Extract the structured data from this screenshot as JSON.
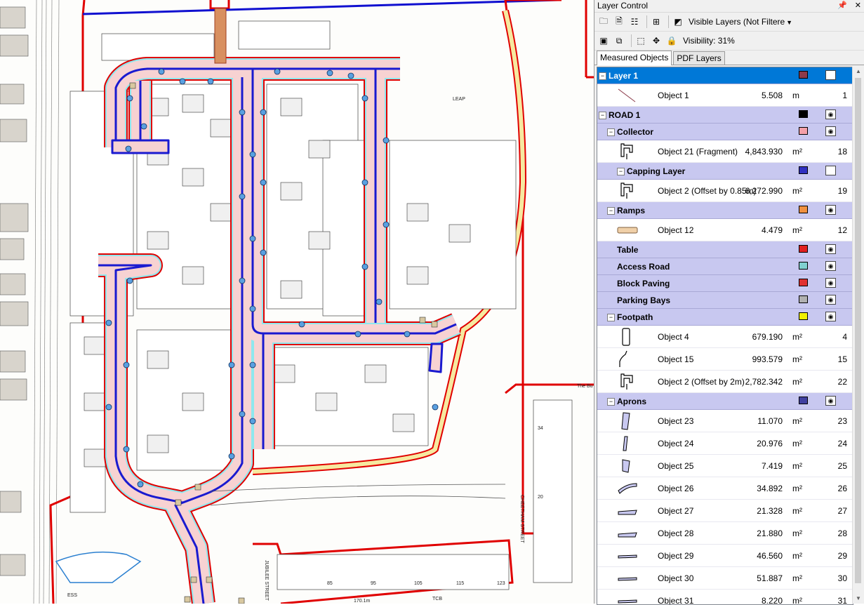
{
  "panel": {
    "title": "Layer Control",
    "title_buttons": [
      "pin-icon",
      "close-icon"
    ],
    "filter_combo": "Visible Layers (Not Filtere",
    "visibility_label": "Visibility: 31%",
    "tabs": [
      {
        "label": "Measured Objects",
        "active": true
      },
      {
        "label": "PDF Layers",
        "active": false
      }
    ]
  },
  "canvas": {
    "labels": [
      "LEAP",
      "CHEETHAM STREET",
      "JUBILEE STREET",
      "ESS",
      "TCB",
      "The Bu",
      "170.1m",
      "85",
      "95",
      "105",
      "115",
      "123",
      "34",
      "20"
    ]
  },
  "tree": [
    {
      "type": "group",
      "level": 0,
      "expander": "−",
      "name": "Layer 1",
      "color": "#8b3a4a",
      "selected": true,
      "eye": true
    },
    {
      "type": "object",
      "icon": "line",
      "name": "Object 1",
      "value": "5.508",
      "unit": "m",
      "id": "1"
    },
    {
      "type": "group",
      "level": 0,
      "expander": "−",
      "name": "ROAD 1",
      "color": "#000000",
      "eye": true
    },
    {
      "type": "group",
      "level": 1,
      "expander": "−",
      "name": "Collector",
      "color": "#f4a0a8",
      "eye": true
    },
    {
      "type": "object",
      "icon": "road",
      "name": "Object 21 (Fragment)",
      "value": "4,843.930",
      "unit": "m²",
      "id": "18"
    },
    {
      "type": "group",
      "level": 2,
      "expander": "−",
      "name": "Capping Layer",
      "color": "#3030c0",
      "eye": false
    },
    {
      "type": "object",
      "icon": "road",
      "name": "Object 2 (Offset by 0.85m)",
      "value": "6,272.990",
      "unit": "m²",
      "id": "19"
    },
    {
      "type": "group",
      "level": 1,
      "expander": "−",
      "name": "Ramps",
      "color": "#f09040",
      "eye": true
    },
    {
      "type": "object",
      "icon": "ramp",
      "name": "Object 12",
      "value": "4.479",
      "unit": "m²",
      "id": "12"
    },
    {
      "type": "group",
      "level": 1,
      "expander": "",
      "name": "Table",
      "color": "#e02020",
      "eye": true
    },
    {
      "type": "group",
      "level": 1,
      "expander": "",
      "name": "Access Road",
      "color": "#80d0d0",
      "eye": true
    },
    {
      "type": "group",
      "level": 1,
      "expander": "",
      "name": "Block Paving",
      "color": "#e03030",
      "eye": true
    },
    {
      "type": "group",
      "level": 1,
      "expander": "",
      "name": "Parking Bays",
      "color": "#b0b0b0",
      "eye": true
    },
    {
      "type": "group",
      "level": 1,
      "expander": "−",
      "name": "Footpath",
      "color": "#f0f000",
      "eye": true
    },
    {
      "type": "object",
      "icon": "rect",
      "name": "Object 4",
      "value": "679.190",
      "unit": "m²",
      "id": "4"
    },
    {
      "type": "object",
      "icon": "curve",
      "name": "Object 15",
      "value": "993.579",
      "unit": "m²",
      "id": "15"
    },
    {
      "type": "object",
      "icon": "road",
      "name": "Object 2 (Offset by 2m)",
      "value": "2,782.342",
      "unit": "m²",
      "id": "22"
    },
    {
      "type": "group",
      "level": 1,
      "expander": "−",
      "name": "Aprons",
      "color": "#4040a0",
      "eye": true
    },
    {
      "type": "object",
      "icon": "apron-tall",
      "name": "Object 23",
      "value": "11.070",
      "unit": "m²",
      "id": "23"
    },
    {
      "type": "object",
      "icon": "apron-thin",
      "name": "Object 24",
      "value": "20.976",
      "unit": "m²",
      "id": "24"
    },
    {
      "type": "object",
      "icon": "apron-short",
      "name": "Object 25",
      "value": "7.419",
      "unit": "m²",
      "id": "25"
    },
    {
      "type": "object",
      "icon": "apron-arc",
      "name": "Object 26",
      "value": "34.892",
      "unit": "m²",
      "id": "26"
    },
    {
      "type": "object",
      "icon": "apron-flat",
      "name": "Object 27",
      "value": "21.328",
      "unit": "m²",
      "id": "27"
    },
    {
      "type": "object",
      "icon": "apron-flat",
      "name": "Object 28",
      "value": "21.880",
      "unit": "m²",
      "id": "28"
    },
    {
      "type": "object",
      "icon": "apron-line",
      "name": "Object 29",
      "value": "46.560",
      "unit": "m²",
      "id": "29"
    },
    {
      "type": "object",
      "icon": "apron-line",
      "name": "Object 30",
      "value": "51.887",
      "unit": "m²",
      "id": "30"
    },
    {
      "type": "object",
      "icon": "apron-line",
      "name": "Object 31",
      "value": "8.220",
      "unit": "m²",
      "id": "31"
    }
  ]
}
